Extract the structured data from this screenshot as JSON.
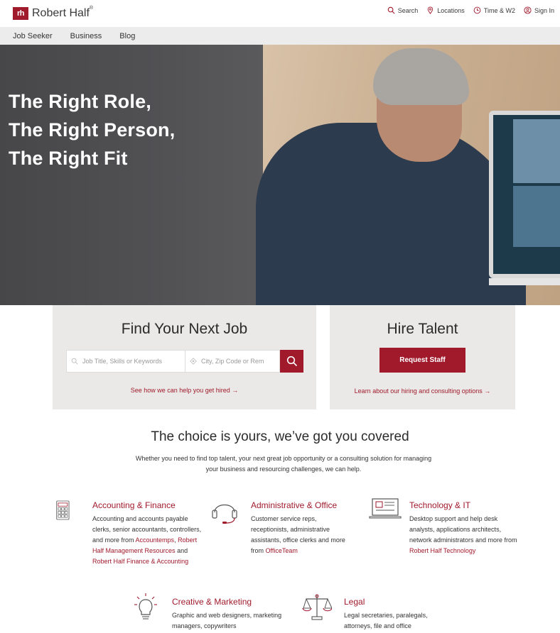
{
  "brand": {
    "mark": "rh",
    "name": "Robert Half",
    "trademark": "®",
    "color": "#a01a2c"
  },
  "util_nav": [
    {
      "label": "Search",
      "icon": "search-icon"
    },
    {
      "label": "Locations",
      "icon": "location-pin-icon"
    },
    {
      "label": "Time & W2",
      "icon": "clock-icon"
    },
    {
      "label": "Sign In",
      "icon": "user-icon"
    }
  ],
  "subnav": [
    "Job Seeker",
    "Business",
    "Blog"
  ],
  "hero": {
    "line1": "The Right Role,",
    "line2": "The Right Person,",
    "line3": "The Right Fit"
  },
  "find_job": {
    "title": "Find Your Next Job",
    "keyword_placeholder": "Job Title, Skills or Keywords",
    "location_placeholder": "City, Zip Code or Rem",
    "link": "See how we can help you get hired →"
  },
  "hire": {
    "title": "Hire Talent",
    "button": "Request Staff",
    "link": "Learn about our hiring and consulting options →"
  },
  "choice": {
    "title": "The choice is yours, we’ve got you covered",
    "desc": "Whether you need to find top talent, your next great job opportunity or a consulting solution for managing your business and resourcing challenges, we can help."
  },
  "categories": {
    "accounting": {
      "title": "Accounting & Finance",
      "text1": "Accounting and accounts payable clerks, senior accountants, controllers, and more from ",
      "link1": "Accountemps",
      "text2": ", ",
      "link2": "Robert Half Management Resources",
      "text3": " and ",
      "link3": "Robert Half Finance & Accounting"
    },
    "admin": {
      "title": "Administrative & Office",
      "text1": "Customer service reps, receptionists, administrative assistants, office clerks and more from ",
      "link1": "OfficeTeam"
    },
    "tech": {
      "title": "Technology & IT",
      "text1": "Desktop support and help desk analysts, applications architects, network administrators and more from ",
      "link1": "Robert Half Technology"
    },
    "creative": {
      "title": "Creative & Marketing",
      "text1": "Graphic and web designers, marketing managers, copywriters"
    },
    "legal": {
      "title": "Legal",
      "text1": "Legal secretaries, paralegals, attorneys, file and office"
    }
  }
}
